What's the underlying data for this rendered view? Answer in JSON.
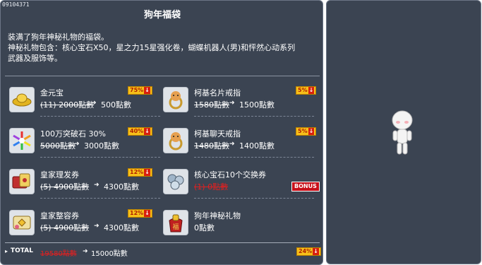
{
  "item_code": "09104371",
  "title": "狗年福袋",
  "description": [
    "装满了狗年神秘礼物的福袋。",
    "神秘礼物包含：核心宝石X50，星之力15星强化卷，蝴蝶机器人(男)和怦然心动系列",
    "武器及服饰等。"
  ],
  "items": [
    {
      "name": "金元宝",
      "old_price": "(11) 2000點數",
      "new_price": "500點數",
      "discount": "75%",
      "icon": "gold-ingot-icon"
    },
    {
      "name": "柯基名片戒指",
      "old_price": "1580點數",
      "new_price": "1500點數",
      "discount": "5%",
      "icon": "corgi-ring-icon"
    },
    {
      "name": "100万突破石  30%",
      "old_price": "5000點數",
      "new_price": "3000點數",
      "discount": "40%",
      "icon": "breakthrough-stone-icon"
    },
    {
      "name": "柯基聊天戒指",
      "old_price": "1480點數",
      "new_price": "1400點數",
      "discount": "5%",
      "icon": "corgi-chat-ring-icon"
    },
    {
      "name": "皇家理发券",
      "old_price": "(5) 4900點數",
      "new_price": "4300點數",
      "discount": "12%",
      "icon": "royal-hair-coupon-icon"
    },
    {
      "name": "核心宝石10个交换券",
      "old_price": "(1) 0點數",
      "new_price": "",
      "bonus": "BONUS",
      "icon": "core-gem-coupon-icon"
    },
    {
      "name": "皇家整容券",
      "old_price": "(5) 4900點數",
      "new_price": "4300點數",
      "discount": "12%",
      "icon": "royal-face-coupon-icon"
    },
    {
      "name": "狗年神秘礼物",
      "old_price": "",
      "new_price": "0點數",
      "icon": "mystery-gift-bag-icon"
    }
  ],
  "total": {
    "label": "TOTAL",
    "old_price": "19580點數",
    "new_price": "15000點數",
    "discount": "24%"
  },
  "colors": {
    "panel": "#3b4452",
    "border": "#6b7585",
    "strike_red": "#e02020",
    "badge_yellow": "#f6c01a"
  }
}
